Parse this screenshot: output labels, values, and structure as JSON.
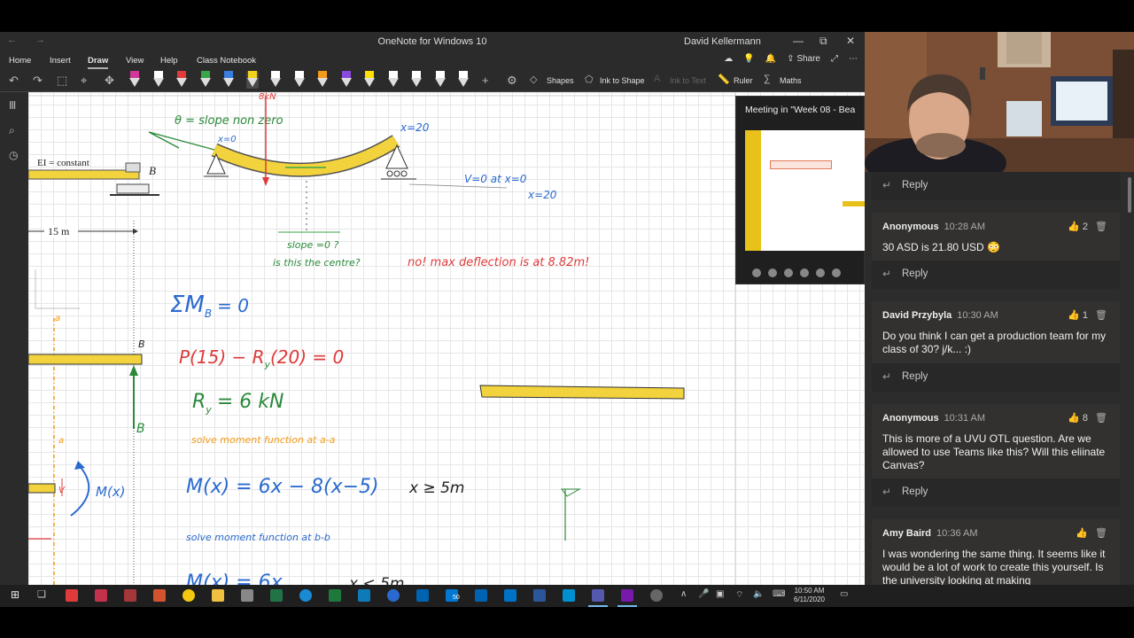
{
  "window": {
    "title": "OneNote for Windows 10",
    "user": "David Kellermann",
    "minimize": "—",
    "maximize": "⧉",
    "close": "✕"
  },
  "menu": {
    "items": [
      "Home",
      "Insert",
      "Draw",
      "View",
      "Help",
      "Class Notebook"
    ],
    "active": "Draw",
    "share": "Share"
  },
  "toolbar": {
    "shapes": "Shapes",
    "ink_to_shape": "Ink to Shape",
    "ink_to_text": "Ink to Text",
    "ruler": "Ruler",
    "maths": "Maths",
    "pen_colors": [
      "#d4379a",
      "#ffffff",
      "#e03a3a",
      "#3aa64a",
      "#3a7de0",
      "#f2d21b",
      "#ffffff",
      "#ffffff",
      "#f29b1b",
      "#8a4ae0",
      "#ffe000",
      "#ffffff",
      "#ffffff",
      "#ffffff",
      "#ffffff"
    ]
  },
  "canvas": {
    "ei_label": "EI = constant",
    "b_label": "B",
    "dim_15m": "15 m",
    "slope_note": "θ = slope non zero",
    "x0_label": "x=0",
    "x20_label": "x=20",
    "load_label": "8kN",
    "v_cond_1": "V=0 at x=0",
    "v_cond_2": "x=20",
    "slope_q": "slope =0 ?",
    "centre_q": "is this the centre?",
    "max_defl": "no! max deflection is at 8.82m!",
    "eq_sum": "ΣM",
    "eq_sum_sub": "B",
    "eq_sum_rhs": "= 0",
    "eq_p": "P(15) − R",
    "eq_p_sub": "y",
    "eq_p_rhs": "(20) = 0",
    "eq_ry": "R",
    "eq_ry_sub": "y",
    "eq_ry_rhs": "= 6 kN",
    "solve_aa": "solve moment function at a-a",
    "mx1": "M(x) = 6x − 8(x−5)",
    "mx1_cond": "x ≥ 5m",
    "solve_bb": "solve moment function at b-b",
    "mx2": "M(x) = 6x",
    "mx2_cond": "x < 5m",
    "label_a_top": "a",
    "label_a_bot": "a",
    "label_b_top": "B",
    "label_b_bot": "B",
    "mx_side": "M(x)",
    "v_side": "V"
  },
  "meeting": {
    "title": "Meeting in \"Week 08 - Bea"
  },
  "chat": {
    "reply_label": "Reply",
    "messages": [
      {
        "author": "Anonymous",
        "time": "10:28 AM",
        "likes": "2",
        "text": "30 ASD is 21.80 USD 😳"
      },
      {
        "author": "David Przybyla",
        "time": "10:30 AM",
        "likes": "1",
        "text": "Do you think I can get a production team for my class of 30? j/k... :)"
      },
      {
        "author": "Anonymous",
        "time": "10:31 AM",
        "likes": "8",
        "text": "This is more of a UVU OTL question. Are we allowed to use Teams like this? Will this eliinate Canvas?"
      },
      {
        "author": "Amy Baird",
        "time": "10:36 AM",
        "likes": "",
        "text": "I was wondering the same thing. It seems like it would be a lot of work to create this yourself. Is the university looking at making"
      }
    ]
  },
  "taskbar": {
    "time": "10:50 AM",
    "date": "6/11/2020",
    "badge": "50"
  }
}
